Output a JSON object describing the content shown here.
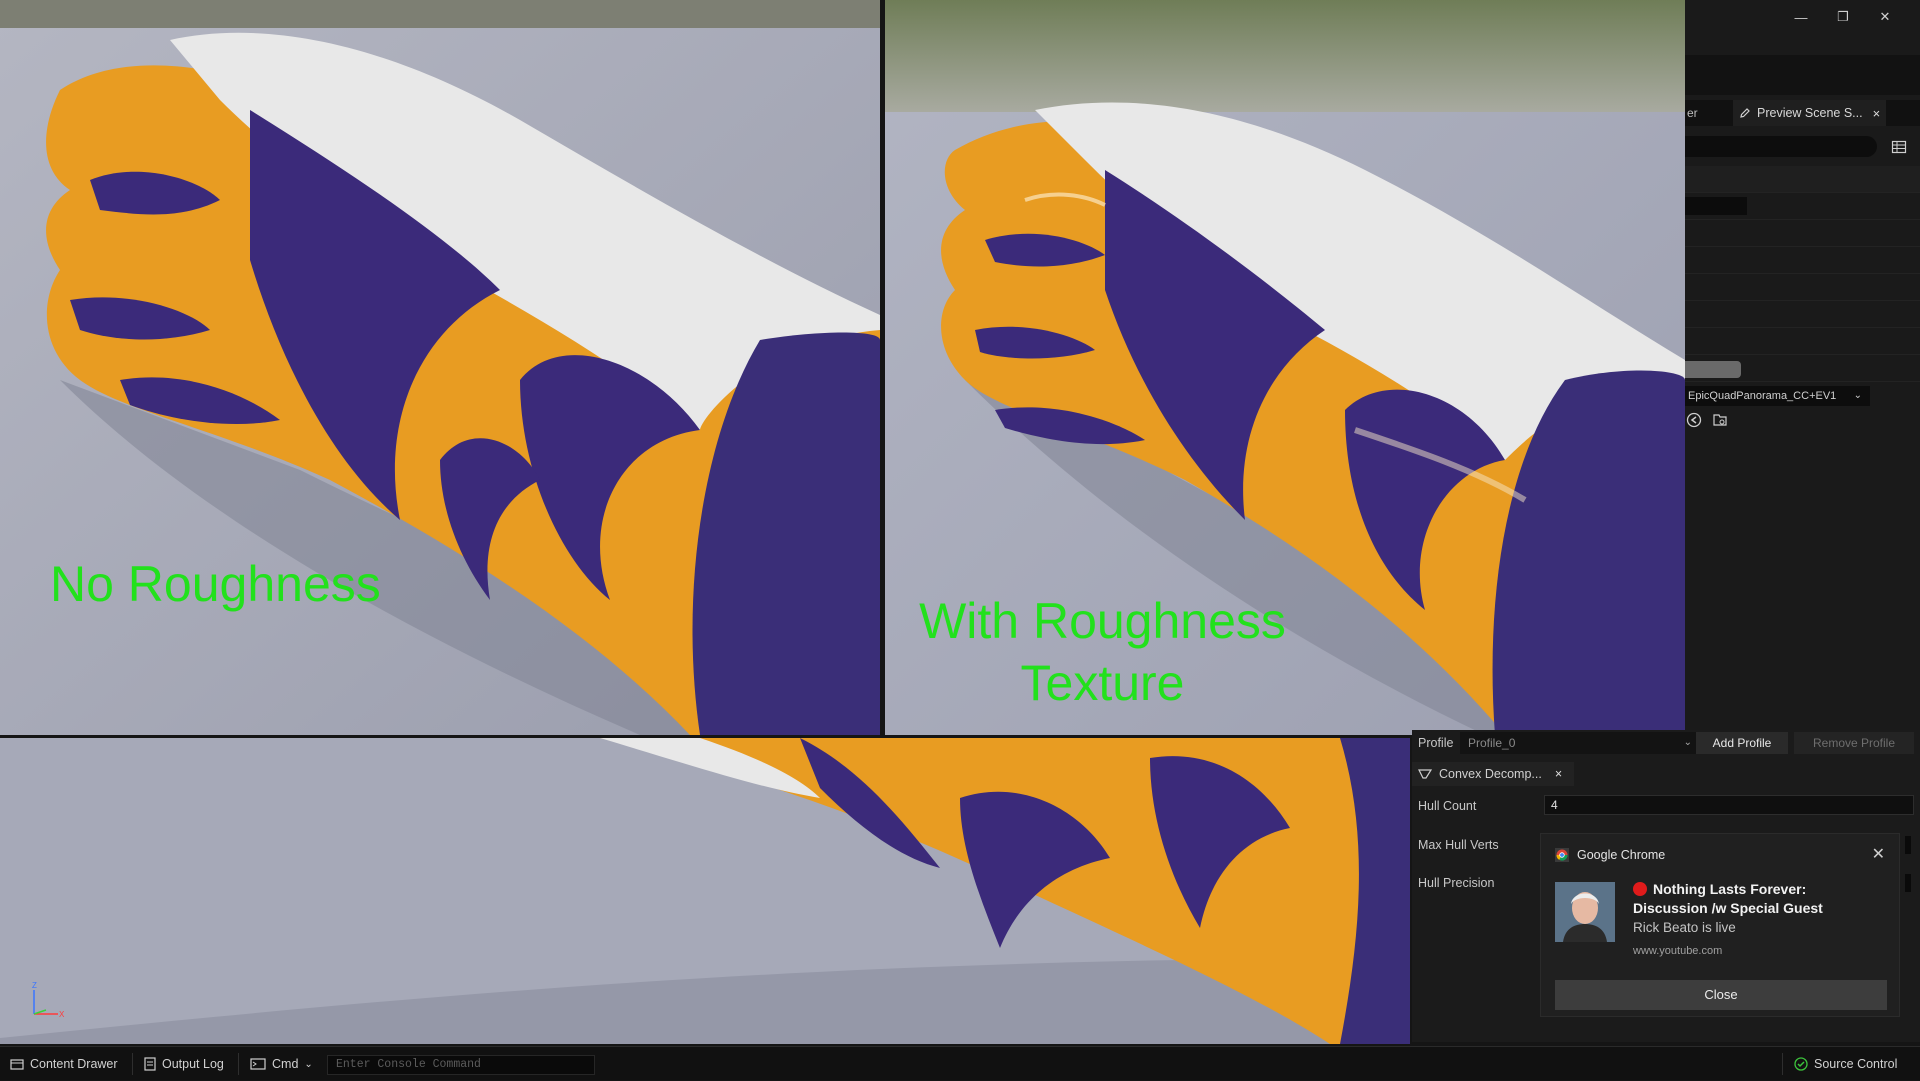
{
  "window": {
    "minimize_glyph": "—",
    "restore_glyph": "❐",
    "close_glyph": "✕"
  },
  "viewports": {
    "left_label": "No Roughness",
    "right_label_line1": "With Roughness",
    "right_label_line2": "Texture"
  },
  "tabs": {
    "partial_label": "er",
    "active_label": "Preview Scene S...",
    "close_glyph": "×"
  },
  "scene": {
    "environment_cubemap": "EpicQuadPanorama_CC+EV1"
  },
  "details": {
    "profile_label": "Profile",
    "profile_value": "Profile_0",
    "add_profile": "Add Profile",
    "remove_profile": "Remove Profile",
    "convex_tab_label": "Convex Decomp...",
    "hull_count_label": "Hull Count",
    "hull_count_value": "4",
    "max_hull_verts_label": "Max Hull Verts",
    "hull_precision_label": "Hull Precision"
  },
  "notification": {
    "app": "Google Chrome",
    "title": "Nothing Lasts Forever: Discussion /w Special Guest",
    "body": "Rick Beato is live",
    "site": "www.youtube.com",
    "close": "Close",
    "dismiss_glyph": "✕"
  },
  "statusbar": {
    "content_drawer": "Content Drawer",
    "output_log": "Output Log",
    "cmd": "Cmd",
    "console_placeholder": "Enter Console Command",
    "source_control": "Source Control"
  },
  "colors": {
    "overlay_text": "#22e11c",
    "glove_gold": "#e89c22",
    "glove_purple": "#3b2a7a",
    "glove_white": "#e6e6e6",
    "viewport_bg": "#a6a9b8"
  }
}
